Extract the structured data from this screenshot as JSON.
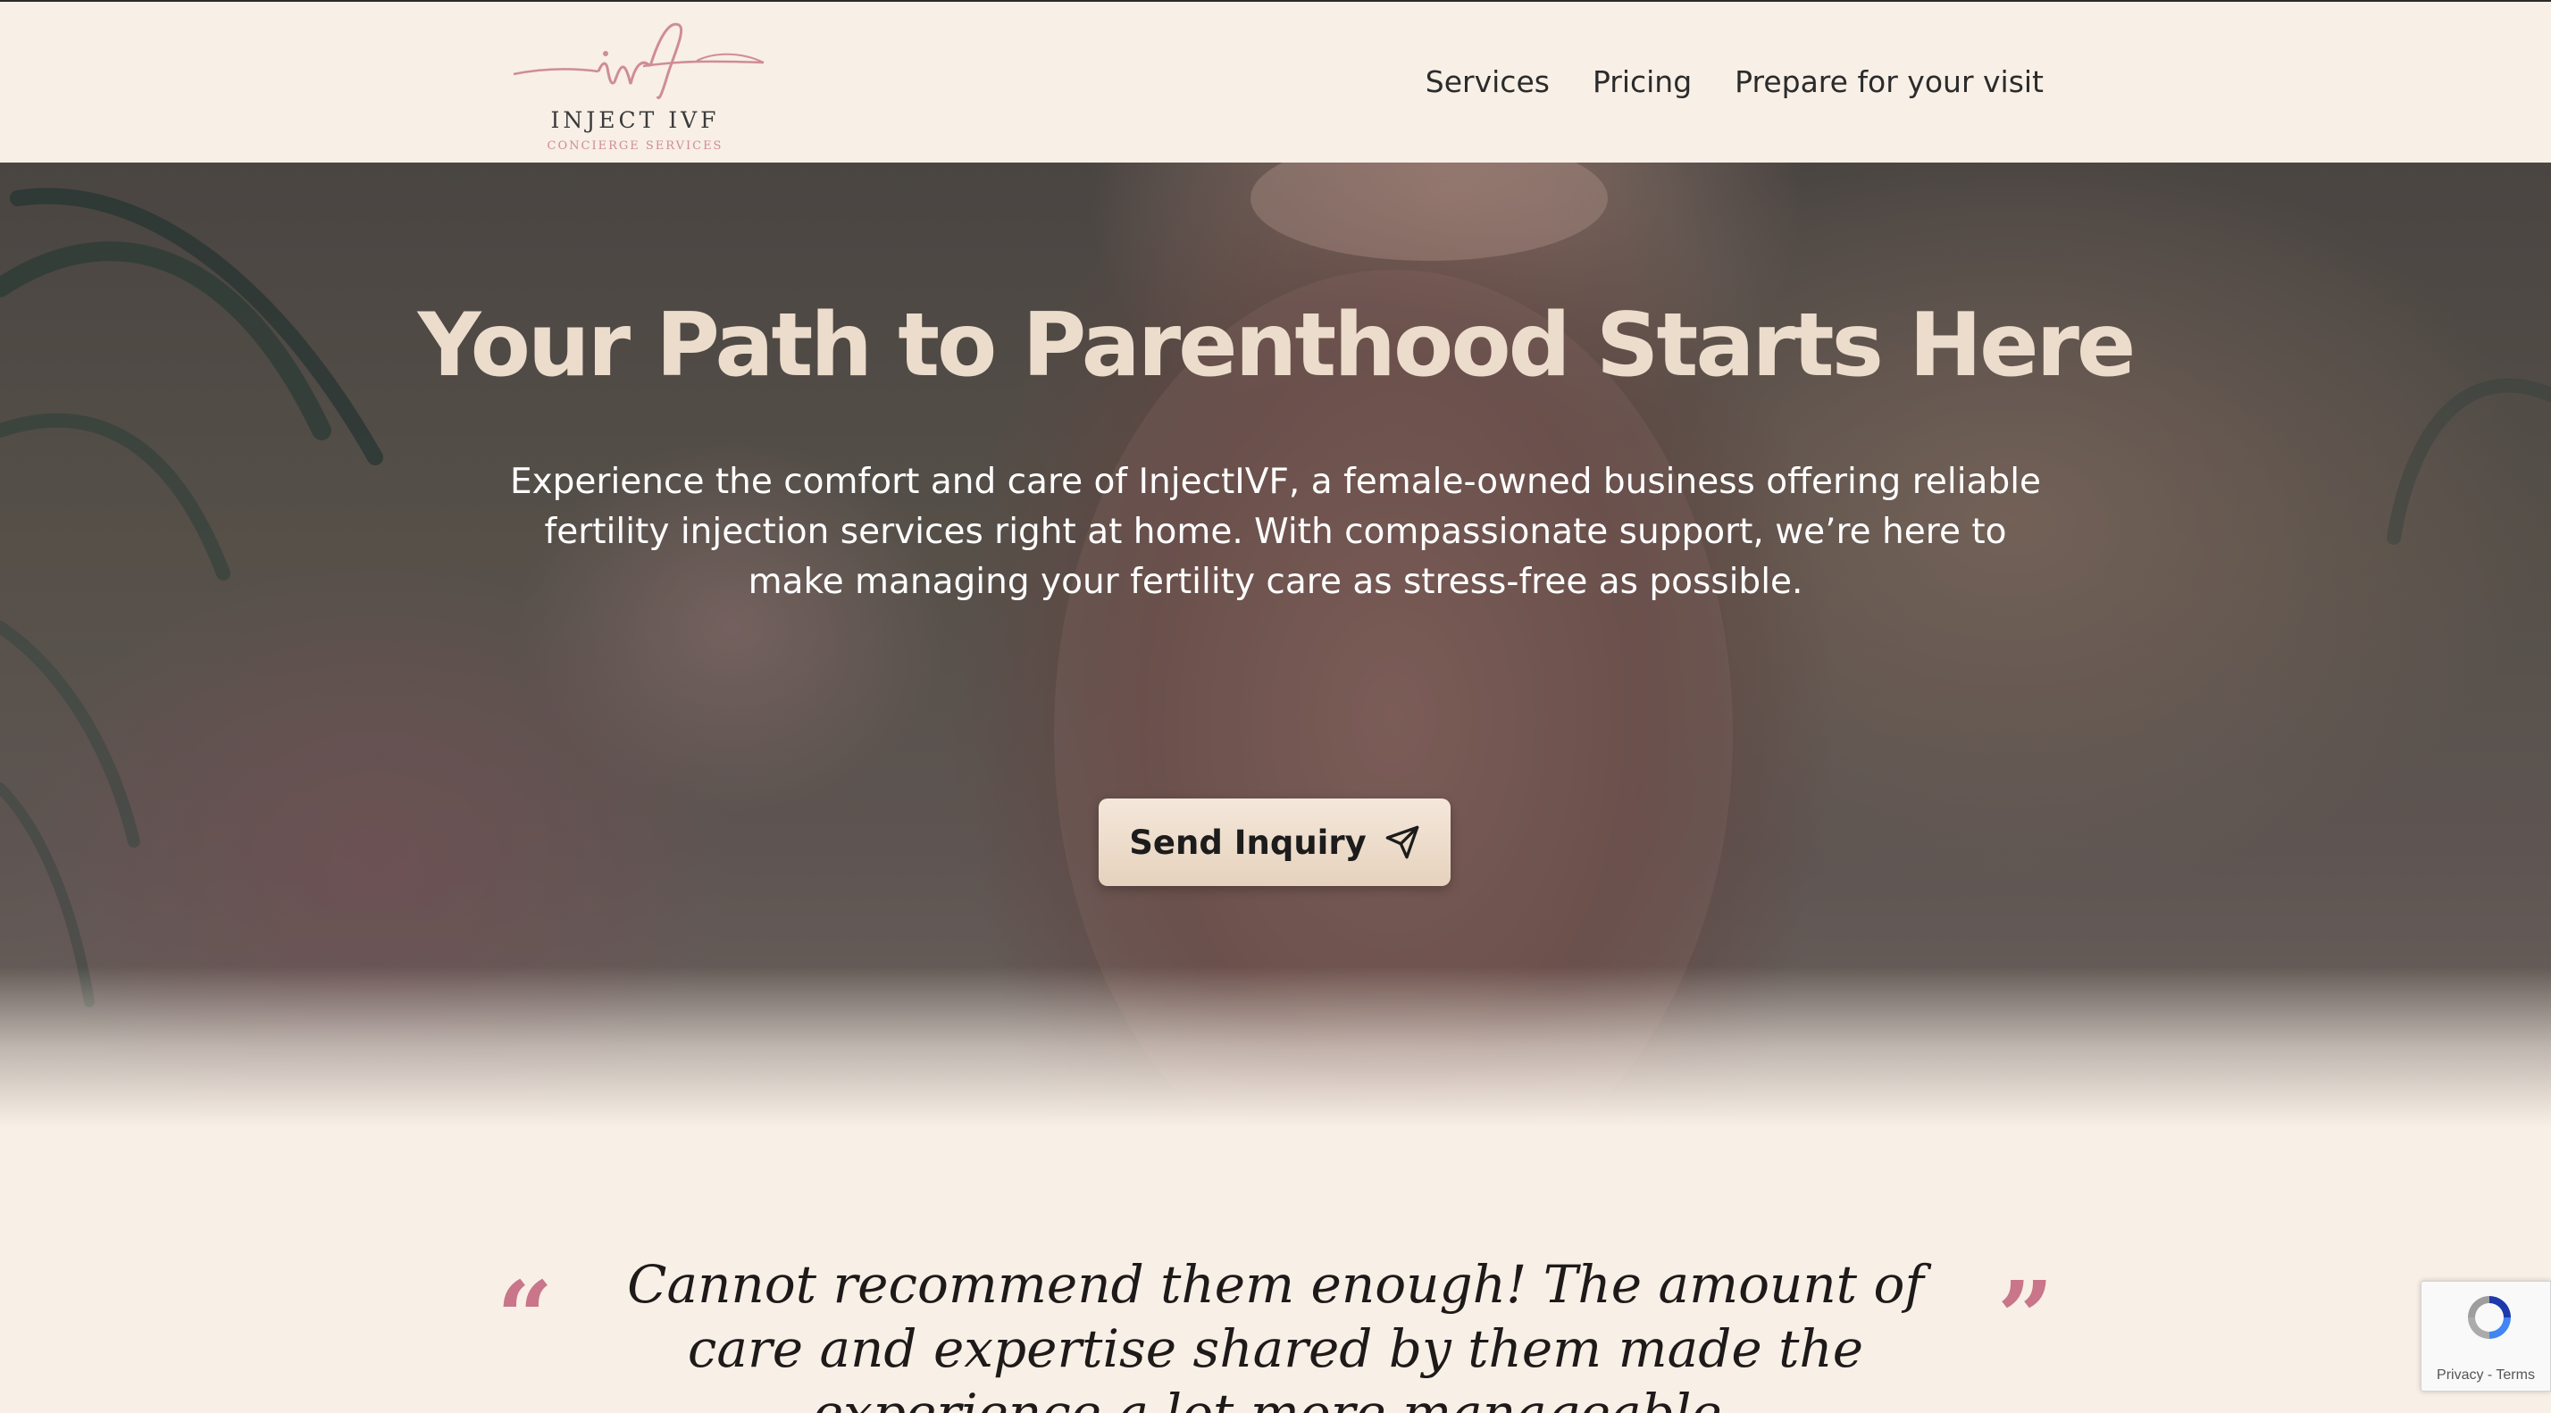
{
  "header": {
    "logo": {
      "script_mark": "ivf",
      "name": "INJECT IVF",
      "tagline": "CONCIERGE SERVICES",
      "accent_color": "#cf8c97"
    },
    "nav": [
      {
        "label": "Services"
      },
      {
        "label": "Pricing"
      },
      {
        "label": "Prepare for your visit"
      }
    ]
  },
  "hero": {
    "title": "Your Path to Parenthood Starts Here",
    "description": "Experience the comfort and care of InjectIVF, a female-owned business offering reliable fertility injection services right at home. With compassionate support, we’re here to make managing your fertility care as stress-free as possible.",
    "cta": {
      "label": "Send Inquiry",
      "icon": "paper-plane-icon"
    },
    "title_color": "#ecdccc"
  },
  "testimonial": {
    "quote": "Cannot recommend them enough! The amount of care and expertise shared by them made the experience a lot more manageable.",
    "open_mark": "“",
    "close_mark": "”",
    "mark_color": "#c9758a"
  },
  "recaptcha": {
    "privacy_label": "Privacy",
    "separator": " - ",
    "terms_label": "Terms"
  }
}
